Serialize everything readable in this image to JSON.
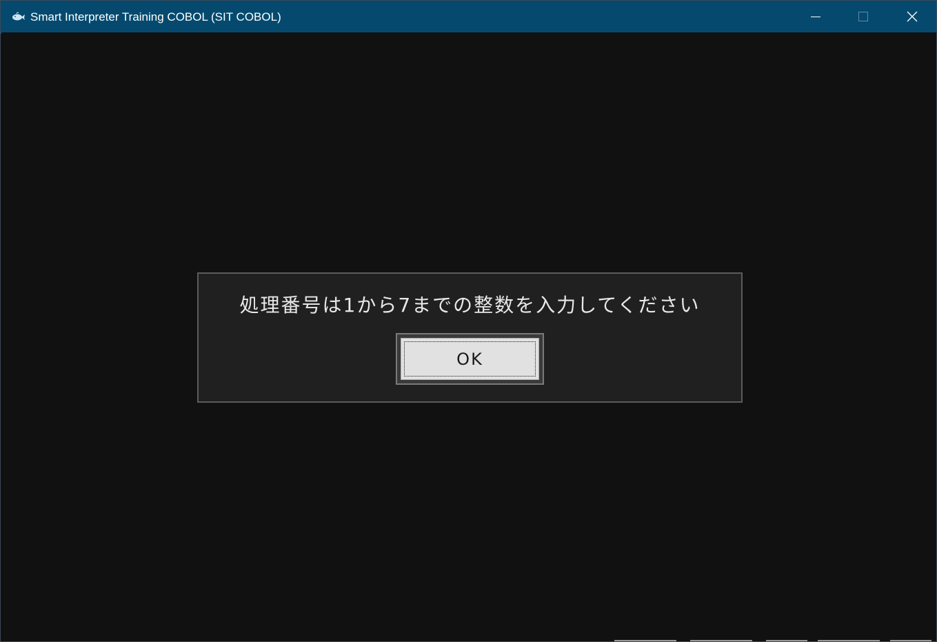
{
  "window": {
    "title": "Smart Interpreter Training COBOL (SIT COBOL)",
    "app_icon": "whale-icon",
    "controls": {
      "minimize_icon": "minimize-icon",
      "maximize_icon": "maximize-icon",
      "close_icon": "close-icon"
    },
    "colors": {
      "titlebar": "#054a6e",
      "client_background": "#111111",
      "dialog_background": "#202020"
    }
  },
  "dialog": {
    "message": "処理番号は1から7までの整数を入力してください",
    "ok_label": "OK"
  }
}
